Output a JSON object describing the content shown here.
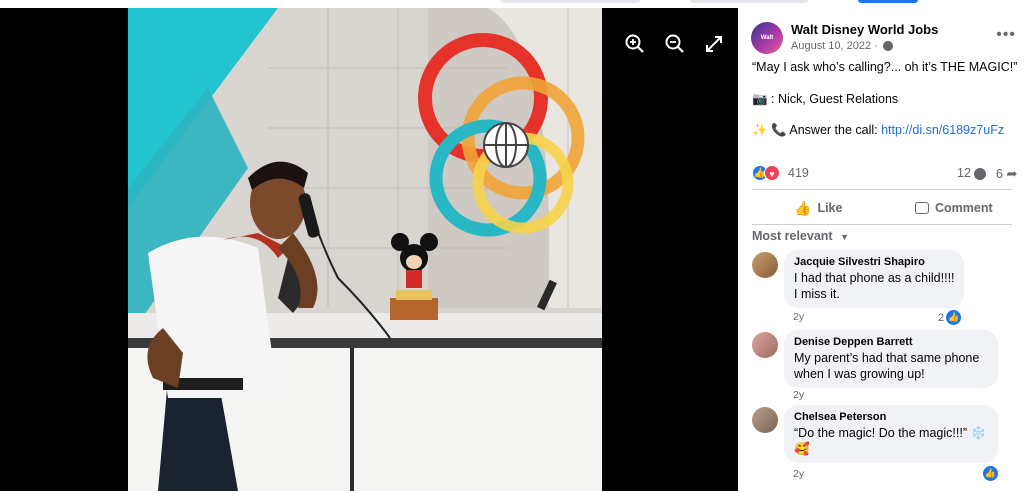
{
  "viewer": {
    "zoom_in_icon": "zoom-in-icon",
    "zoom_out_icon": "zoom-out-icon",
    "fullscreen_icon": "fullscreen-icon"
  },
  "post": {
    "page_name": "Walt Disney World Jobs",
    "avatar_text": "Walt Disney JOBS",
    "date": "August 10, 2022 ·",
    "line1": "“May I ask who’s calling?... oh it’s THE MAGIC!”",
    "line2": "📷 : Nick, Guest Relations",
    "line3_prefix": "✨ 📞 Answer the call: ",
    "line3_link": "http://di.sn/6189z7uFz",
    "reaction_count": "419",
    "comment_count": "12",
    "share_count": "6"
  },
  "actions": {
    "like": "Like",
    "comment": "Comment"
  },
  "comments_filter": "Most relevant",
  "comments": [
    {
      "name": "Jacquie Silvestri Shapiro",
      "text1": "I had that phone as a child!!!!",
      "text2": "I miss it.",
      "time": "2y",
      "likes": "2"
    },
    {
      "name": "Denise Deppen Barrett",
      "text1": "My parent’s had that same phone",
      "text2": "when I was growing up!",
      "time": "2y"
    },
    {
      "name": "Chelsea Peterson",
      "text1": "“Do the magic! Do the magic!!!” ❄️",
      "text2": "🥰",
      "time": "2y"
    }
  ],
  "colors": {
    "link": "#216fdb",
    "like_blue": "#1877f2",
    "love_red": "#f33e58",
    "bubble": "#f0f2f5"
  }
}
